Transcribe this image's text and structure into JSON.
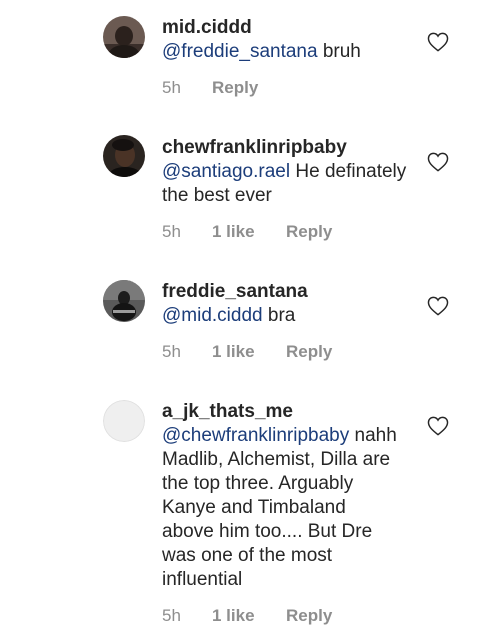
{
  "comments": [
    {
      "username": "mid.ciddd",
      "mention": "@freddie_santana",
      "text": " bruh",
      "time": "5h",
      "likes": "",
      "reply": "Reply"
    },
    {
      "username": "chewfranklinripbaby",
      "mention": "@santiago.rael",
      "text": " He definately the best ever",
      "time": "5h",
      "likes": "1 like",
      "reply": "Reply"
    },
    {
      "username": "freddie_santana",
      "mention": "@mid.ciddd",
      "text": " bra",
      "time": "5h",
      "likes": "1 like",
      "reply": "Reply"
    },
    {
      "username": "a_jk_thats_me",
      "mention": "@chewfranklinripbaby",
      "text": " nahh Madlib, Alchemist, Dilla are the top three. Arguably Kanye and Timbaland above him too.... But Dre was one of the most influential",
      "time": "5h",
      "likes": "1 like",
      "reply": "Reply"
    }
  ],
  "icons": {
    "heart": "heart-outline-icon",
    "avatar_empty": "#e8e8e8"
  }
}
